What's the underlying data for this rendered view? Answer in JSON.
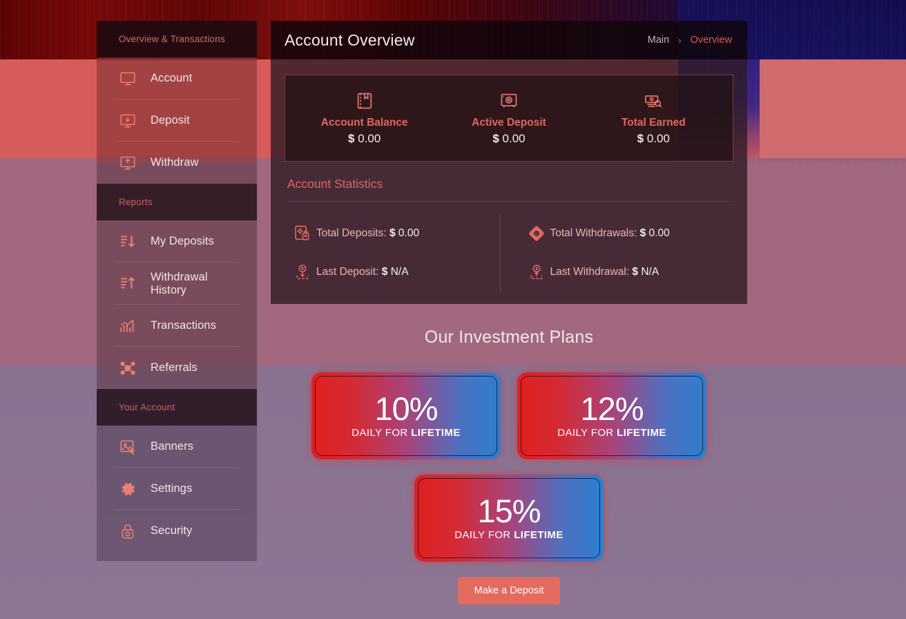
{
  "theme": {
    "accent": "#e0675f",
    "accent_light": "#ef7f6d",
    "plan_gradient_start": "#e02020",
    "plan_gradient_end": "#2b7fd0",
    "button_bg": "#e4695e"
  },
  "sidebar": {
    "sections": [
      {
        "header": "Overview & Transactions",
        "items": [
          {
            "label": "Account",
            "icon": "monitor-icon"
          },
          {
            "label": "Deposit",
            "icon": "monitor-download-icon"
          },
          {
            "label": "Withdraw",
            "icon": "monitor-upload-icon"
          }
        ]
      },
      {
        "header": "Reports",
        "items": [
          {
            "label": "My Deposits",
            "icon": "list-arrow-down-icon"
          },
          {
            "label": "Withdrawal History",
            "icon": "list-arrow-up-icon"
          },
          {
            "label": "Transactions",
            "icon": "bar-chart-icon"
          },
          {
            "label": "Referrals",
            "icon": "network-nodes-icon"
          }
        ]
      },
      {
        "header": "Your Account",
        "items": [
          {
            "label": "Banners",
            "icon": "image-cursor-icon"
          },
          {
            "label": "Settings",
            "icon": "gear-icon"
          },
          {
            "label": "Security",
            "icon": "lock-gear-icon"
          }
        ]
      }
    ]
  },
  "header": {
    "title": "Account Overview",
    "breadcrumb": {
      "root": "Main",
      "separator": "›",
      "current": "Overview"
    }
  },
  "summary": {
    "cards": [
      {
        "label": "Account Balance",
        "currency": "$",
        "value": "0.00",
        "icon": "wallet-icon"
      },
      {
        "label": "Active Deposit",
        "currency": "$",
        "value": "0.00",
        "icon": "safe-icon"
      },
      {
        "label": "Total Earned",
        "currency": "$",
        "value": "0.00",
        "icon": "money-search-icon"
      }
    ]
  },
  "statistics": {
    "title": "Account Statistics",
    "rows_left": [
      {
        "label": "Total Deposits:",
        "currency": "$",
        "value": "0.00",
        "icon": "deposit-secure-icon"
      },
      {
        "label": "Last Deposit:",
        "currency": "$",
        "value": "N/A",
        "icon": "coin-in-icon"
      }
    ],
    "rows_right": [
      {
        "label": "Total Withdrawals:",
        "currency": "$",
        "value": "0.00",
        "icon": "diamond-coin-icon"
      },
      {
        "label": "Last Withdrawal:",
        "currency": "$",
        "value": "N/A",
        "icon": "coin-out-icon"
      }
    ]
  },
  "plans": {
    "title": "Our Investment Plans",
    "items": [
      {
        "percent": "10%",
        "sub_prefix": "DAILY FOR ",
        "sub_strong": "LIFETIME"
      },
      {
        "percent": "12%",
        "sub_prefix": "DAILY FOR ",
        "sub_strong": "LIFETIME"
      },
      {
        "percent": "15%",
        "sub_prefix": "DAILY FOR ",
        "sub_strong": "LIFETIME"
      }
    ],
    "cta": "Make a Deposit"
  }
}
